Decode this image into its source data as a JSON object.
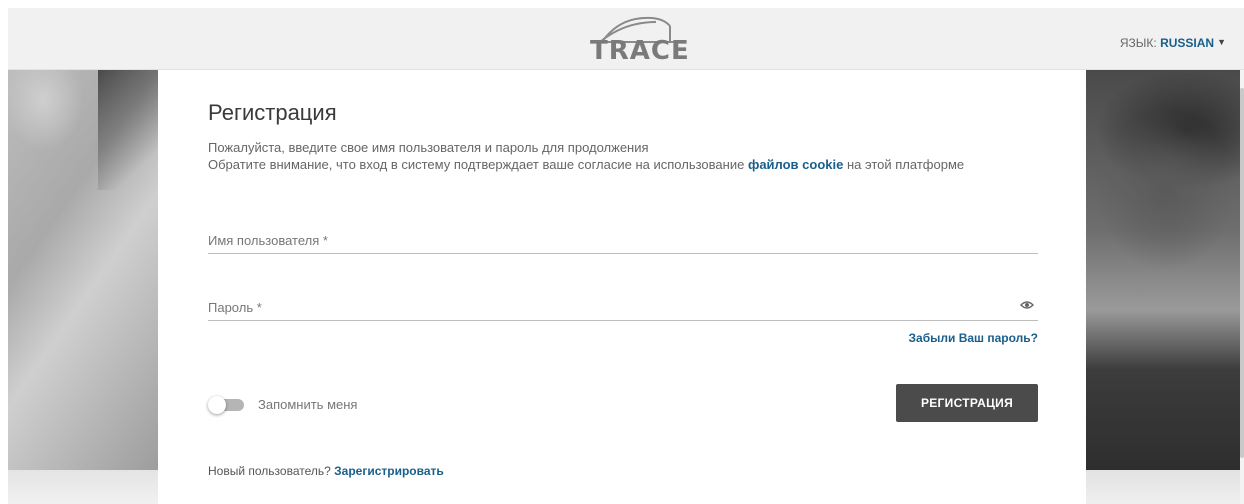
{
  "header": {
    "logo_text": "TRACE",
    "language_label": "ЯЗЫК:",
    "language_value": "RUSSIAN"
  },
  "login": {
    "title": "Регистрация",
    "subtitle_line1": "Пожалуйста, введите свое имя пользователя и пароль для продолжения",
    "subtitle_line2_prefix": "Обратите внимание, что вход в систему подтверждает ваше согласие на использование",
    "cookie_link": "файлов cookie",
    "subtitle_line2_suffix": "на этой платформе",
    "username_placeholder": "Имя пользователя *",
    "username_value": "",
    "password_placeholder": "Пароль *",
    "password_value": "",
    "forgot_password": "Забыли Ваш пароль?",
    "remember_me": "Запомнить меня",
    "remember_me_checked": false,
    "login_button": "РЕГИСТРАЦИЯ",
    "new_user_prefix": "Новый пользователь?",
    "register_link": "Зарегистрировать"
  },
  "colors": {
    "accent_link": "#1a5f8a",
    "button_bg": "#4b4b4b",
    "header_bg": "#f1f1f1"
  },
  "icons": {
    "password_toggle": "eye-icon",
    "language_dropdown": "caret-down-icon",
    "logo": "trace-bridge-logo"
  }
}
